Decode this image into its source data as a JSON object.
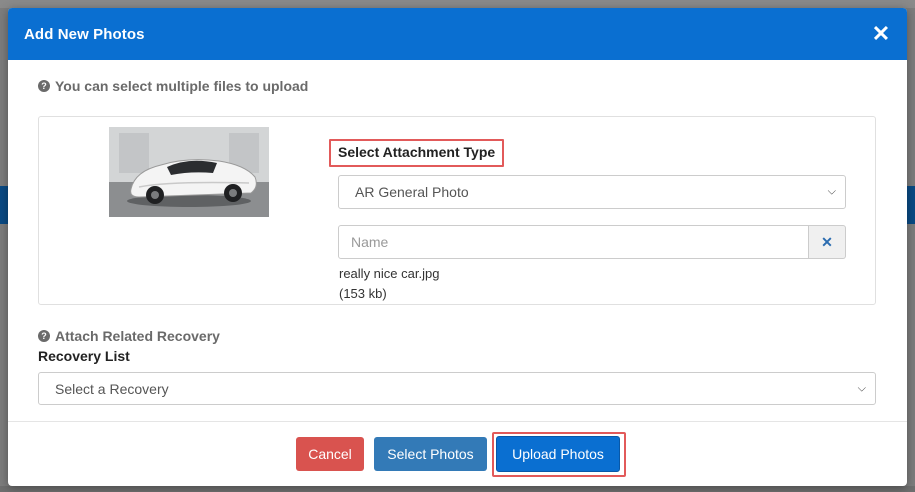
{
  "modal": {
    "title": "Add New Photos",
    "close_icon": "close-icon"
  },
  "hint": {
    "icon": "question-circle-icon",
    "text": "You can select multiple files to upload"
  },
  "attachment": {
    "thumbnail_icon": "car-photo-thumbnail",
    "type_label": "Select Attachment Type",
    "type_selected": "AR General Photo",
    "name_placeholder": "Name",
    "clear_icon": "close-icon",
    "file_name": "really nice car.jpg",
    "file_size": "(153 kb)"
  },
  "recovery": {
    "hint_icon": "question-circle-icon",
    "hint_text": "Attach Related Recovery",
    "label": "Recovery List",
    "selected": "Select a Recovery"
  },
  "footer": {
    "cancel_label": "Cancel",
    "select_label": "Select Photos",
    "upload_label": "Upload Photos"
  },
  "colors": {
    "header": "#0a6fd1",
    "cancel": "#d9534f",
    "select": "#337ab7",
    "upload": "#0a6fd1",
    "highlight": "#e25a5a"
  }
}
